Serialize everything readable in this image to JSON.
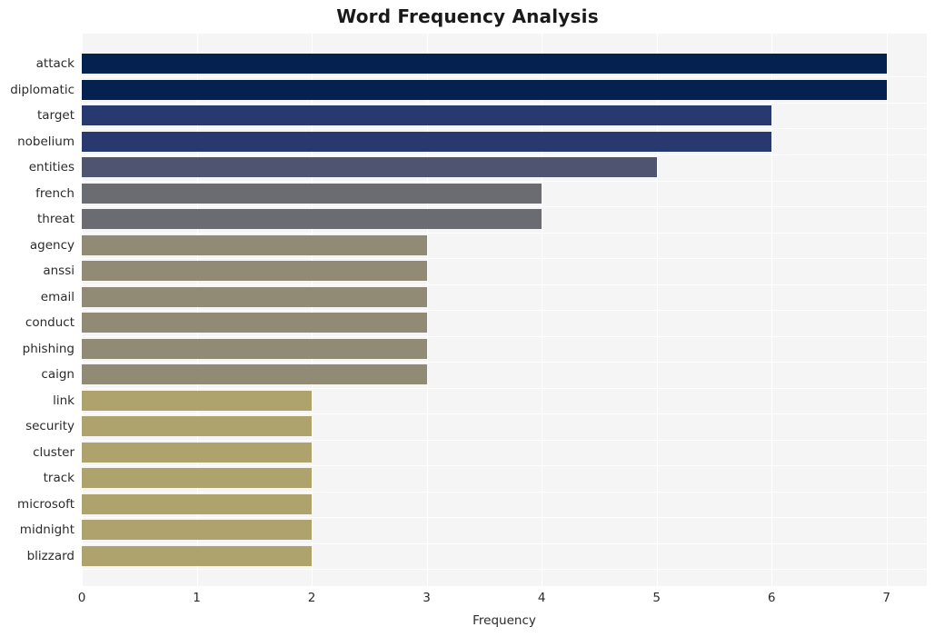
{
  "chart_data": {
    "type": "bar",
    "orientation": "horizontal",
    "title": "Word Frequency Analysis",
    "xlabel": "Frequency",
    "ylabel": "",
    "xlim": [
      0,
      7.35
    ],
    "xticks": [
      "0",
      "1",
      "2",
      "3",
      "4",
      "5",
      "6",
      "7"
    ],
    "xtick_values": [
      0,
      1,
      2,
      3,
      4,
      5,
      6,
      7
    ],
    "grid": true,
    "legend": "none",
    "plot_background": "#f5f5f6",
    "gridline_color": "#ffffff",
    "categories": [
      "attack",
      "diplomatic",
      "target",
      "nobelium",
      "entities",
      "french",
      "threat",
      "agency",
      "anssi",
      "email",
      "conduct",
      "phishing",
      "caign",
      "link",
      "security",
      "cluster",
      "track",
      "microsoft",
      "midnight",
      "blizzard"
    ],
    "values": [
      7,
      7,
      6,
      6,
      5,
      4,
      4,
      3,
      3,
      3,
      3,
      3,
      3,
      2,
      2,
      2,
      2,
      2,
      2,
      2
    ],
    "bar_colors": [
      "#042150",
      "#042150",
      "#27396e",
      "#27396e",
      "#4f5570",
      "#6b6c72",
      "#6b6c72",
      "#918a75",
      "#918a75",
      "#918a75",
      "#918a75",
      "#918a75",
      "#918a75",
      "#aea26d",
      "#aea26d",
      "#aea26d",
      "#aea26d",
      "#aea26d",
      "#aea26d",
      "#aea26d"
    ]
  }
}
